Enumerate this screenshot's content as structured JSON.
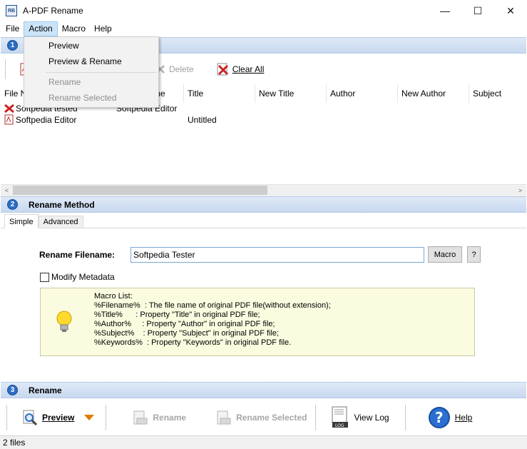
{
  "window": {
    "title": "A-PDF Rename",
    "app_icon_text": "RB",
    "minimize": "—",
    "maximize": "☐",
    "close": "✕"
  },
  "menubar": {
    "items": [
      "File",
      "Action",
      "Macro",
      "Help"
    ],
    "active": "Action"
  },
  "action_menu": {
    "items": [
      {
        "label": "Preview",
        "enabled": true
      },
      {
        "label": "Preview & Rename",
        "enabled": true
      },
      {
        "label": "Rename",
        "enabled": false
      },
      {
        "label": "Rename Selected",
        "enabled": false
      }
    ]
  },
  "section1": {
    "number": "1",
    "toolbar": {
      "delete_label": "Delete",
      "clear_all_label": "Clear All"
    },
    "columns": [
      "File N",
      "me",
      "Title",
      "New Title",
      "Author",
      "New Author",
      "Subject"
    ],
    "rows": [
      {
        "file_name": "Softpedia tested",
        "new_name": "Softpedia Editor",
        "title": "",
        "icon": "error-x-icon"
      },
      {
        "file_name": "Softpedia Editor",
        "new_name": "",
        "title": "Untitled",
        "icon": "pdf-file-icon"
      }
    ],
    "scroll_left": "<",
    "scroll_right": ">"
  },
  "section2": {
    "number": "2",
    "title": "Rename Method",
    "tabs": [
      "Simple",
      "Advanced"
    ],
    "selected_tab": "Simple",
    "rename_filename_label": "Rename Filename:",
    "rename_filename_value": "Softpedia Tester",
    "macro_button": "Macro",
    "help_button": "?",
    "modify_metadata_label": "Modify Metadata",
    "modify_metadata_checked": false,
    "macro_list": [
      "Macro List:",
      "%Filename%  : The file name of original PDF file(without extension);",
      "%Title%      : Property \"Title\" in original PDF file;",
      "%Author%     : Property \"Author\" in original PDF file;",
      "%Subject%    : Property \"Subject\" in original PDF file;",
      "%Keywords%  : Property \"Keywords\" in original PDF file."
    ]
  },
  "section3": {
    "number": "3",
    "title": "Rename",
    "toolbar": {
      "preview_label": "Preview",
      "rename_label": "Rename",
      "rename_selected_label": "Rename Selected",
      "view_log_label": "View Log",
      "help_label": "Help"
    }
  },
  "status": {
    "text": "2 files"
  },
  "colors": {
    "header_gradient_top": "#dfe9f7",
    "header_gradient_bottom": "#c7d8ef",
    "step_badge": "#2b6cc4",
    "macro_box_bg": "#fbfbe0",
    "menu_highlight": "#cce4f7",
    "error_red": "#cc2222",
    "help_blue": "#2a6fd1",
    "preview_arrow": "#e07b00"
  }
}
